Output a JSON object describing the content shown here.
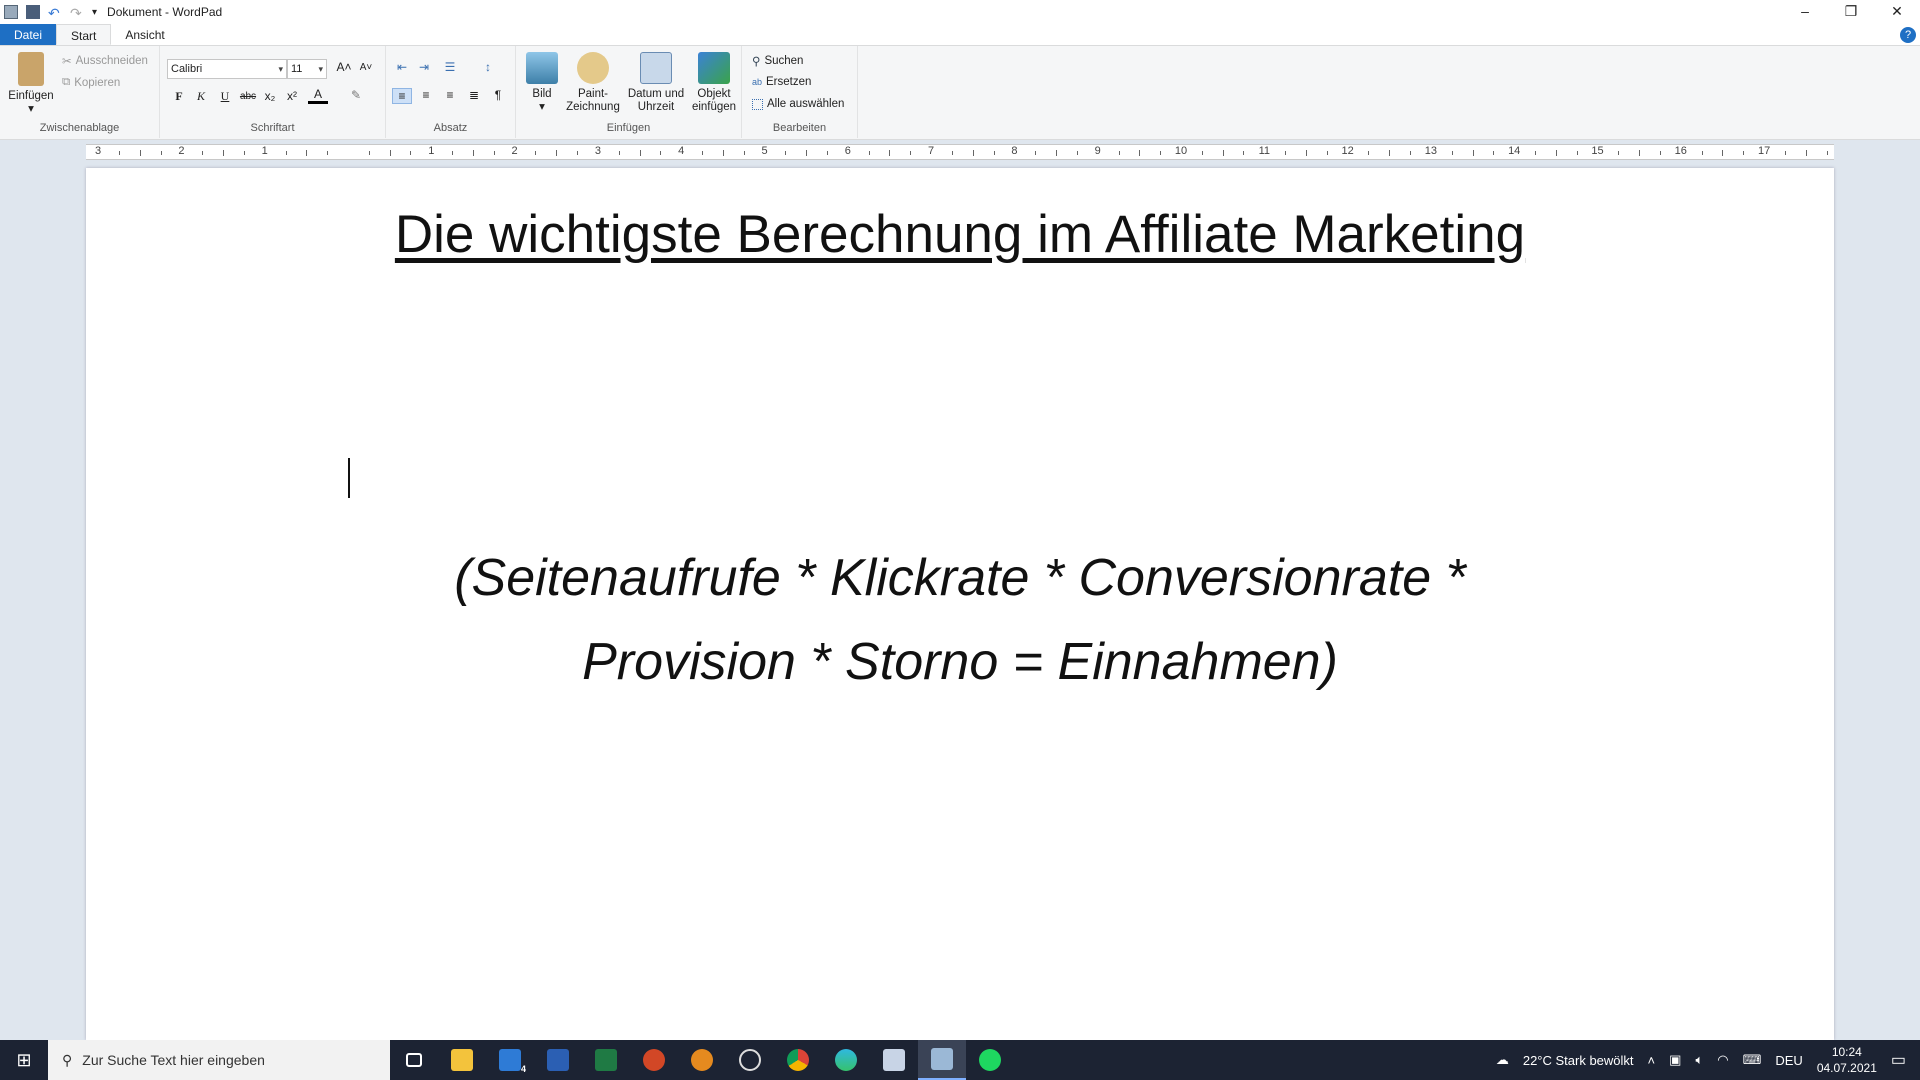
{
  "window": {
    "title": "Dokument - WordPad",
    "minimize": "–",
    "restore": "❐",
    "close": "✕"
  },
  "tabs": [
    {
      "label": "Datei"
    },
    {
      "label": "Start"
    },
    {
      "label": "Ansicht"
    }
  ],
  "ribbon": {
    "clipboard": {
      "label": "Zwischenablage",
      "paste": "Einfügen",
      "cut": "Ausschneiden",
      "copy": "Kopieren"
    },
    "font": {
      "label": "Schriftart",
      "family": "Calibri",
      "size": "11",
      "bold": "F",
      "italic": "K",
      "underline": "U",
      "strike": "abc",
      "sub": "x₂",
      "sup": "x²",
      "color": "A"
    },
    "paragraph": {
      "label": "Absatz"
    },
    "insert": {
      "label": "Einfügen",
      "picture": "Bild",
      "paint": "Paint-Zeichnung",
      "datetime": "Datum und Uhrzeit",
      "object": "Objekt einfügen"
    },
    "edit": {
      "label": "Bearbeiten",
      "find": "Suchen",
      "replace": "Ersetzen",
      "select_all": "Alle auswählen"
    }
  },
  "ruler": {
    "numbers": [
      "3",
      "2",
      "1",
      "",
      "1",
      "2",
      "3",
      "4",
      "5",
      "6",
      "7",
      "8",
      "9",
      "10",
      "11",
      "12",
      "13",
      "14",
      "15",
      "16",
      "17"
    ]
  },
  "document": {
    "title": "Die wichtigste Berechnung im Affiliate Marketing",
    "formula_line1": "(Seitenaufrufe * Klickrate * Conversionrate *",
    "formula_line2": "Provision * Storno = Einnahmen)"
  },
  "taskbar": {
    "search_placeholder": "Zur Suche Text hier eingeben",
    "weather": "22°C  Stark bewölkt",
    "language": "DEU",
    "time": "10:24",
    "date": "04.07.2021",
    "mail_badge": "4"
  },
  "colors": {
    "accent": "#1e6fc4",
    "taskbar": "#1c2333"
  }
}
